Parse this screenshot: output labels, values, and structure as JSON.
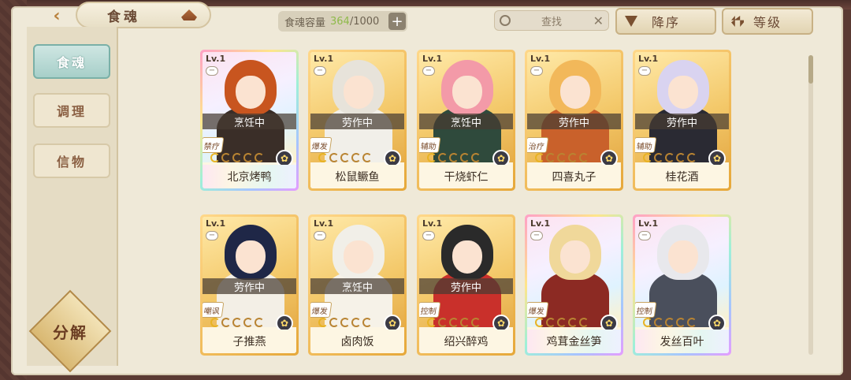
{
  "header": {
    "title": "食魂",
    "capacity_label": "食魂容量",
    "capacity_used": "364",
    "capacity_max": "/1000",
    "search_label": "查找",
    "sort_order_label": "降序",
    "sort_by_label": "等级"
  },
  "sidebar": {
    "items": [
      {
        "label": "食魂",
        "active": true
      },
      {
        "label": "调理",
        "active": false
      },
      {
        "label": "信物",
        "active": false
      }
    ],
    "decompose_label": "分解"
  },
  "cards": [
    {
      "level": "Lv.1",
      "status": "烹饪中",
      "role": "禁疗",
      "name": "北京烤鸭",
      "rainbow": true,
      "gold_stars": 1,
      "hair": "#c8551f",
      "outfit": "#3a2e28"
    },
    {
      "level": "Lv.1",
      "status": "劳作中",
      "role": "爆发",
      "name": "松鼠鳜鱼",
      "rainbow": false,
      "gold_stars": 1,
      "hair": "#e7e3da",
      "outfit": "#f1efe9"
    },
    {
      "level": "Lv.1",
      "status": "烹饪中",
      "role": "辅助",
      "name": "干烧虾仁",
      "rainbow": false,
      "gold_stars": 1,
      "hair": "#f39aa8",
      "outfit": "#2f4a3c"
    },
    {
      "level": "Lv.1",
      "status": "劳作中",
      "role": "治疗",
      "name": "四喜丸子",
      "rainbow": false,
      "gold_stars": 1,
      "hair": "#f2b85a",
      "outfit": "#c9612b"
    },
    {
      "level": "Lv.1",
      "status": "劳作中",
      "role": "辅助",
      "name": "桂花酒",
      "rainbow": false,
      "gold_stars": 1,
      "hair": "#d9d3f0",
      "outfit": "#2a2a33"
    },
    {
      "level": "Lv.1",
      "status": "劳作中",
      "role": "嘲讽",
      "name": "子推燕",
      "rainbow": false,
      "gold_stars": 1,
      "hair": "#1f2747",
      "outfit": "#f3efe6"
    },
    {
      "level": "Lv.1",
      "status": "烹饪中",
      "role": "爆发",
      "name": "卤肉饭",
      "rainbow": false,
      "gold_stars": 1,
      "hair": "#f1efe8",
      "outfit": "#f6f2e8"
    },
    {
      "level": "Lv.1",
      "status": "劳作中",
      "role": "控制",
      "name": "绍兴醉鸡",
      "rainbow": false,
      "gold_stars": 1,
      "hair": "#2a2a2a",
      "outfit": "#c9302b"
    },
    {
      "level": "Lv.1",
      "status": "",
      "role": "爆发",
      "name": "鸡茸金丝笋",
      "rainbow": true,
      "gold_stars": 1,
      "hair": "#f0d89a",
      "outfit": "#8c2a23"
    },
    {
      "level": "Lv.1",
      "status": "",
      "role": "控制",
      "name": "发丝百叶",
      "rainbow": true,
      "gold_stars": 1,
      "hair": "#e8e8ec",
      "outfit": "#4a4f5c"
    }
  ]
}
